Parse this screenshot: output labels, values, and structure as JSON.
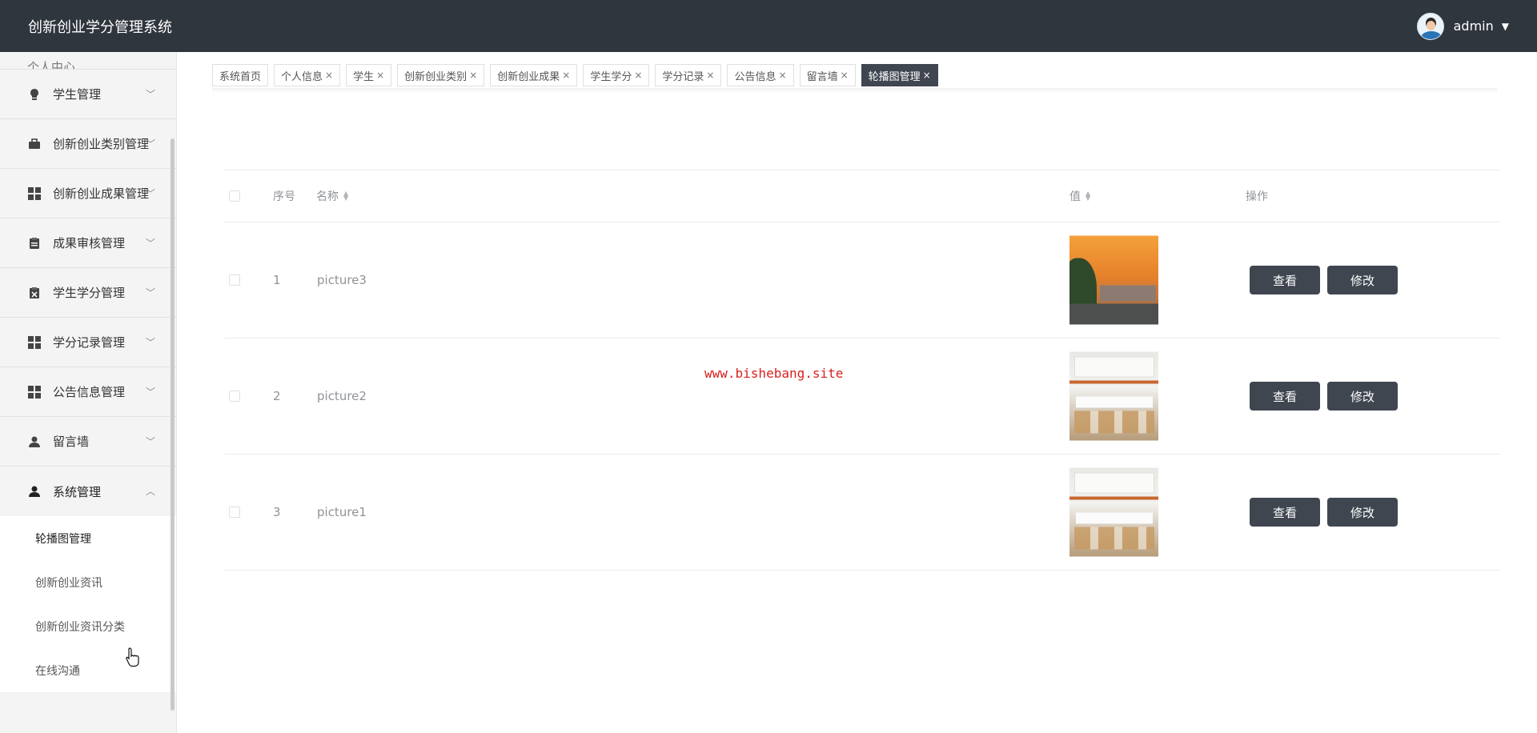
{
  "app": {
    "title": "创新创业学分管理系统"
  },
  "user": {
    "name": "admin",
    "caret": "▼"
  },
  "sidebar": {
    "partial_label": "个人中心",
    "items": [
      {
        "label": "学生管理",
        "icon": "bulb-icon"
      },
      {
        "label": "创新创业类别管理",
        "icon": "briefcase-icon"
      },
      {
        "label": "创新创业成果管理",
        "icon": "grid-icon"
      },
      {
        "label": "成果审核管理",
        "icon": "clipboard-icon"
      },
      {
        "label": "学生学分管理",
        "icon": "clipboard-x-icon"
      },
      {
        "label": "学分记录管理",
        "icon": "grid-icon"
      },
      {
        "label": "公告信息管理",
        "icon": "grid-icon"
      },
      {
        "label": "留言墙",
        "icon": "user-icon"
      },
      {
        "label": "系统管理",
        "icon": "user-icon",
        "expanded": true
      }
    ],
    "sub_items": [
      {
        "label": "轮播图管理"
      },
      {
        "label": "创新创业资讯"
      },
      {
        "label": "创新创业资讯分类"
      },
      {
        "label": "在线沟通"
      }
    ]
  },
  "tabs": [
    {
      "label": "系统首页",
      "closable": false
    },
    {
      "label": "个人信息",
      "closable": true
    },
    {
      "label": "学生",
      "closable": true
    },
    {
      "label": "创新创业类别",
      "closable": true
    },
    {
      "label": "创新创业成果",
      "closable": true
    },
    {
      "label": "学生学分",
      "closable": true
    },
    {
      "label": "学分记录",
      "closable": true
    },
    {
      "label": "公告信息",
      "closable": true
    },
    {
      "label": "留言墙",
      "closable": true
    },
    {
      "label": "轮播图管理",
      "closable": true,
      "active": true
    }
  ],
  "tab_close_glyph": "×",
  "table": {
    "headers": {
      "index": "序号",
      "name": "名称",
      "value": "值",
      "actions": "操作"
    },
    "rows": [
      {
        "index": "1",
        "name": "picture3",
        "image": "sunset-street"
      },
      {
        "index": "2",
        "name": "picture2",
        "image": "classroom"
      },
      {
        "index": "3",
        "name": "picture1",
        "image": "classroom"
      }
    ],
    "view_label": "查看",
    "edit_label": "修改"
  },
  "watermark": "www.bishebang.site",
  "colors": {
    "header_bg": "#30363e",
    "button_bg": "#3f4650",
    "sidebar_bg": "#f4f4f4",
    "watermark": "#d91f1f"
  }
}
